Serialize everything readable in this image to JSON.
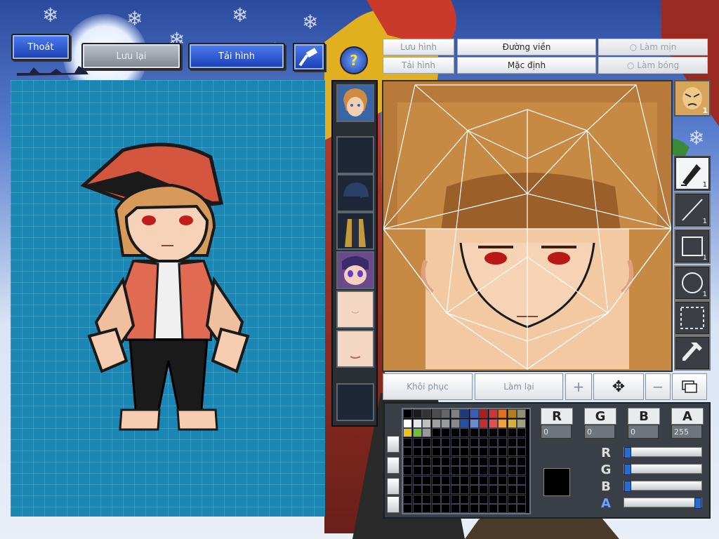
{
  "top_buttons": {
    "exit_label": "Thoát",
    "save_label": "Lưu lại",
    "reload_label": "Tải hình"
  },
  "editor_toolbar": {
    "save_image_label": "Lưu hình",
    "load_image_label": "Tải hình",
    "outline_label": "Đường viền",
    "default_label": "Mặc định",
    "smooth_label": "Làm mịn",
    "shiny_label": "Làm bóng"
  },
  "tools": [
    {
      "name": "pen",
      "count": "1"
    },
    {
      "name": "line",
      "count": "1"
    },
    {
      "name": "rectangle",
      "count": "1"
    },
    {
      "name": "ellipse",
      "count": "1"
    },
    {
      "name": "select",
      "count": ""
    },
    {
      "name": "eyedropper",
      "count": ""
    }
  ],
  "face_badge_count": "1",
  "bottom_toolbar": {
    "restore_label": "Khôi phục",
    "redo_label": "Làm lại"
  },
  "color_channels": {
    "R": "0",
    "G": "0",
    "B": "0",
    "A": "255"
  },
  "slider_labels": [
    "R",
    "G",
    "B",
    "A"
  ],
  "slider_values": [
    0,
    0,
    0,
    1
  ],
  "current_color": "#000000",
  "palette_colors": [
    "#000000",
    "#1a1a1a",
    "#333333",
    "#4d4d4d",
    "#666666",
    "#808080",
    "#1f3a7a",
    "#3a5fb0",
    "#b31a1a",
    "#d43333",
    "#e07020",
    "#b08020",
    "#909070",
    "#ffffff",
    "#e6e6e6",
    "#c0c0c0",
    "#a0a0a0",
    "#9a9a9a",
    "#8a8a8a",
    "#2a4fa0",
    "#6a8ad0",
    "#c03030",
    "#e05050",
    "#f0a040",
    "#d0b040",
    "#a0a080",
    "#f0c020",
    "#70c030",
    "#999999"
  ]
}
